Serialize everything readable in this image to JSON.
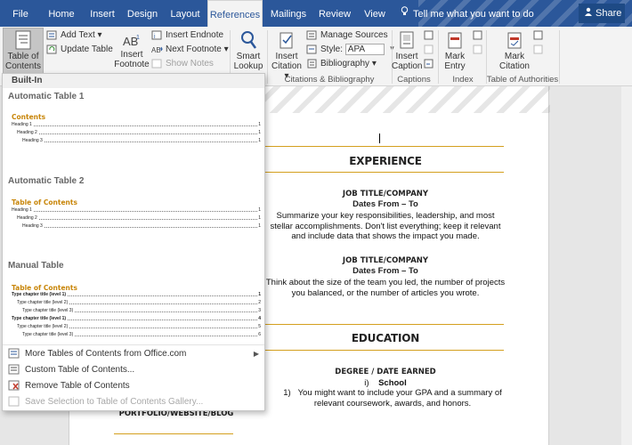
{
  "tabs": [
    {
      "label": "File",
      "active": false
    },
    {
      "label": "Home",
      "active": false
    },
    {
      "label": "Insert",
      "active": false
    },
    {
      "label": "Design",
      "active": false
    },
    {
      "label": "Layout",
      "active": false
    },
    {
      "label": "References",
      "active": true
    },
    {
      "label": "Mailings",
      "active": false
    },
    {
      "label": "Review",
      "active": false
    },
    {
      "label": "View",
      "active": false
    }
  ],
  "tell_me": "Tell me what you want to do",
  "share": "Share",
  "ribbon": {
    "toc_button": "Table of\nContents ▾",
    "add_text": "Add Text ▾",
    "update_table": "Update Table",
    "insert_footnote": "Insert\nFootnote",
    "insert_endnote": "Insert Endnote",
    "next_footnote": "Next Footnote ▾",
    "show_notes": "Show Notes",
    "smart_lookup": "Smart\nLookup",
    "insert_citation": "Insert\nCitation ▾",
    "manage_sources": "Manage Sources",
    "style_label": "Style:",
    "style_value": "APA",
    "bibliography": "Bibliography ▾",
    "insert_caption": "Insert\nCaption",
    "mark_entry": "Mark\nEntry",
    "mark_citation": "Mark\nCitation",
    "groups": {
      "citations": "Citations & Bibliography",
      "captions": "Captions",
      "index": "Index",
      "authorities": "Table of Authorities"
    }
  },
  "dropdown": {
    "header": "Built-In",
    "auto1": {
      "name": "Automatic Table 1",
      "title": "Contents",
      "lines": [
        {
          "text": "Heading 1",
          "page": "1",
          "level": 1
        },
        {
          "text": "Heading 2",
          "page": "1",
          "level": 2
        },
        {
          "text": "Heading 3",
          "page": "1",
          "level": 3
        }
      ]
    },
    "auto2": {
      "name": "Automatic Table 2",
      "title": "Table of Contents",
      "lines": [
        {
          "text": "Heading 1",
          "page": "1",
          "level": 1
        },
        {
          "text": "Heading 2",
          "page": "1",
          "level": 2
        },
        {
          "text": "Heading 3",
          "page": "1",
          "level": 3
        }
      ]
    },
    "manual": {
      "name": "Manual Table",
      "title": "Table of Contents",
      "lines": [
        {
          "text": "Type chapter title (level 1)",
          "page": "1",
          "level": 1
        },
        {
          "text": "Type chapter title (level 2)",
          "page": "2",
          "level": 2
        },
        {
          "text": "Type chapter title (level 3)",
          "page": "3",
          "level": 3
        },
        {
          "text": "Type chapter title (level 1)",
          "page": "4",
          "level": 1
        },
        {
          "text": "Type chapter title (level 2)",
          "page": "5",
          "level": 2
        },
        {
          "text": "Type chapter title (level 3)",
          "page": "6",
          "level": 3
        }
      ]
    },
    "more_tocs": "More Tables of Contents from Office.com",
    "custom_toc": "Custom Table of Contents...",
    "remove_toc": "Remove Table of Contents",
    "save_selection": "Save Selection to Table of Contents Gallery..."
  },
  "document": {
    "experience_heading": "EXPERIENCE",
    "job1_title": "JOB TITLE/COMPANY",
    "job1_dates": "Dates From – To",
    "job1_desc": "Summarize your key responsibilities, leadership, and most stellar accomplishments. Don't list everything; keep it relevant and include data that shows the impact you made.",
    "job2_title": "JOB TITLE/COMPANY",
    "job2_dates": "Dates From – To",
    "job2_desc": "Think about the size of the team you led, the number of projects you balanced, or the number of articles you wrote.",
    "education_heading": "EDUCATION",
    "degree": "DEGREE / DATE EARNED",
    "school_num": "i)",
    "school": "School",
    "gpa_num": "1)",
    "gpa_desc": "You might want to include your GPA and a summary of relevant coursework, awards, and honors.",
    "portfolio": "PORTFOLIO/WEBSITE/BLOG"
  }
}
